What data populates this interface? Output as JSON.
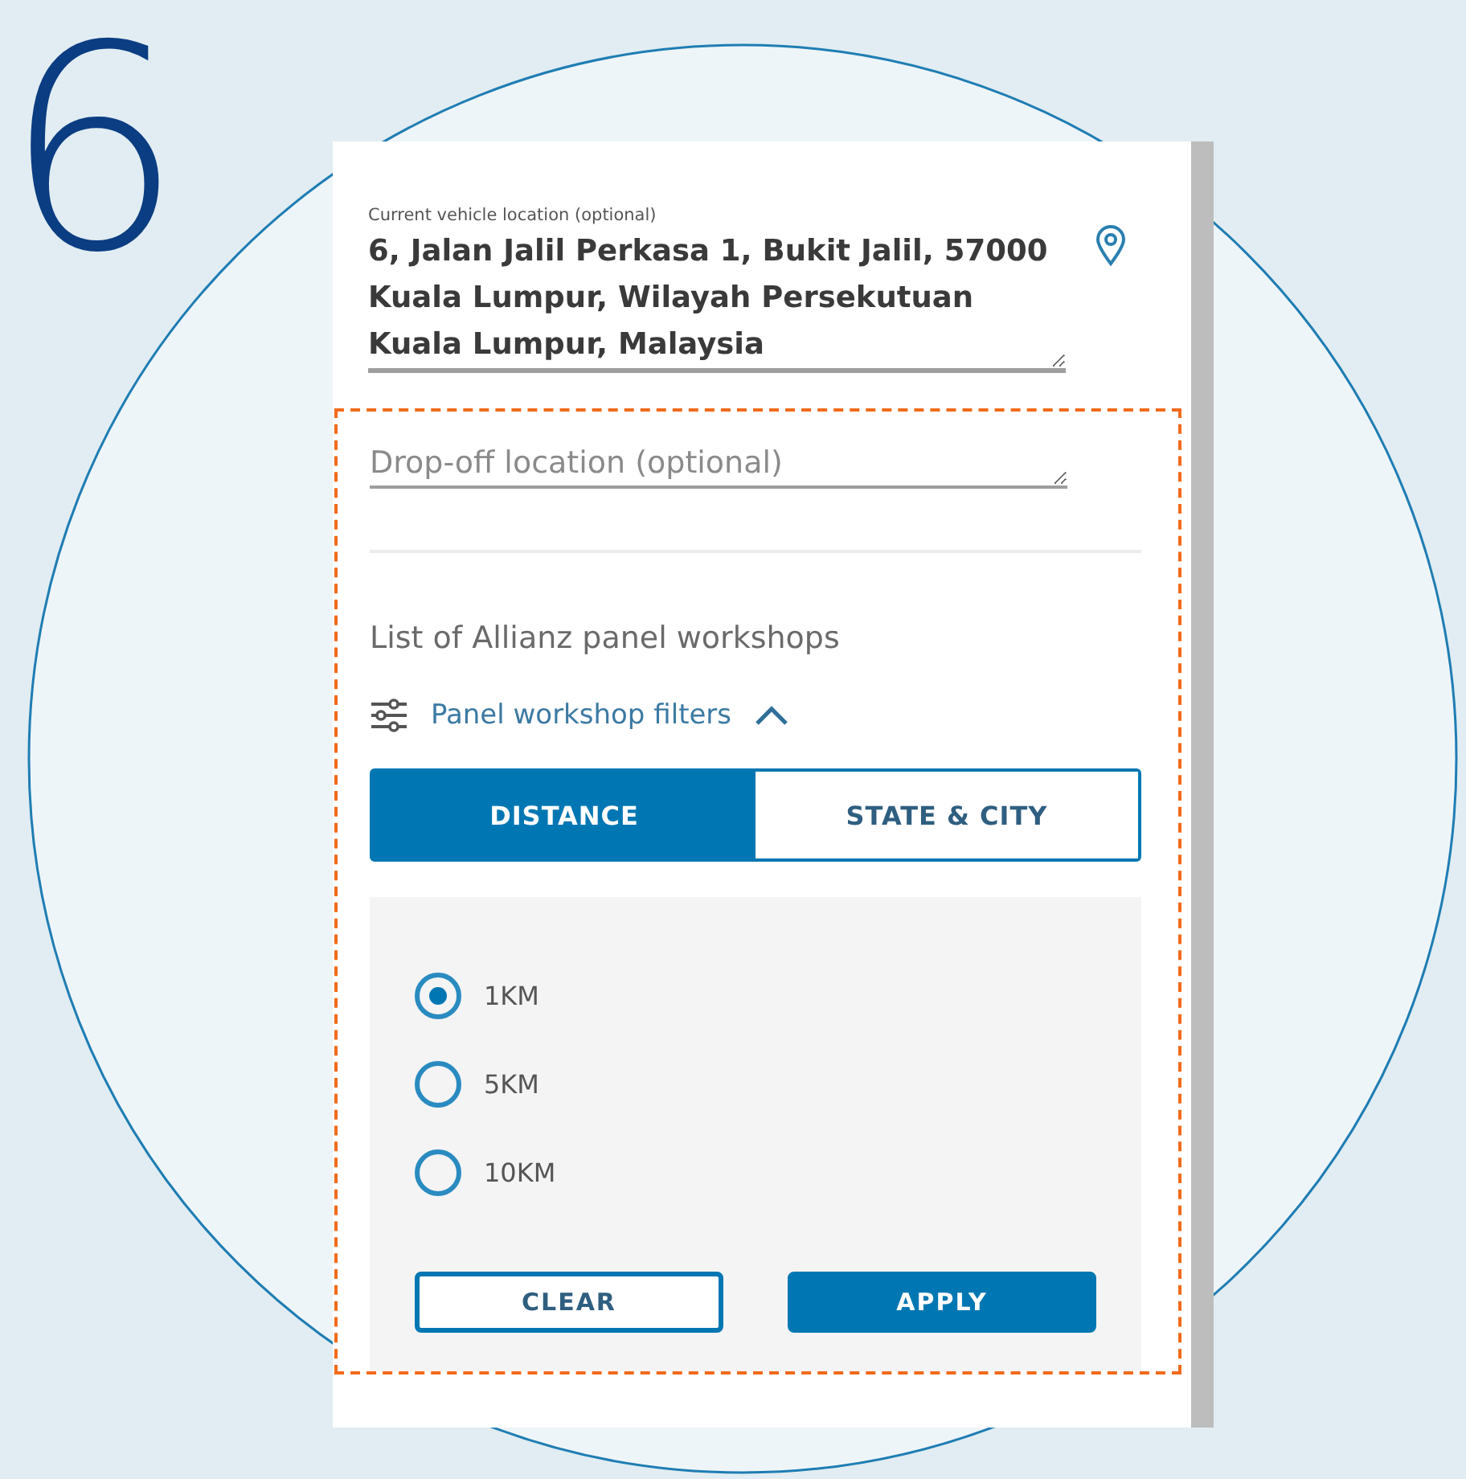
{
  "step_number": "6",
  "current_location": {
    "label": "Current vehicle location (optional)",
    "value": "6, Jalan Jalil Perkasa 1, Bukit Jalil, 57000 Kuala Lumpur, Wilayah Persekutuan Kuala Lumpur, Malaysia"
  },
  "dropoff": {
    "placeholder": "Drop-off location (optional)"
  },
  "workshops_heading": "List of Allianz panel workshops",
  "filters": {
    "label": "Panel workshop filters",
    "expanded": true
  },
  "tabs": [
    {
      "label": "DISTANCE",
      "selected": true
    },
    {
      "label": "STATE & CITY",
      "selected": false
    }
  ],
  "distance_options": [
    {
      "label": "1KM",
      "selected": true
    },
    {
      "label": "5KM",
      "selected": false
    },
    {
      "label": "10KM",
      "selected": false
    }
  ],
  "buttons": [
    {
      "label": "CLEAR",
      "kind": "outline"
    },
    {
      "label": "APPLY",
      "kind": "primary"
    }
  ]
}
